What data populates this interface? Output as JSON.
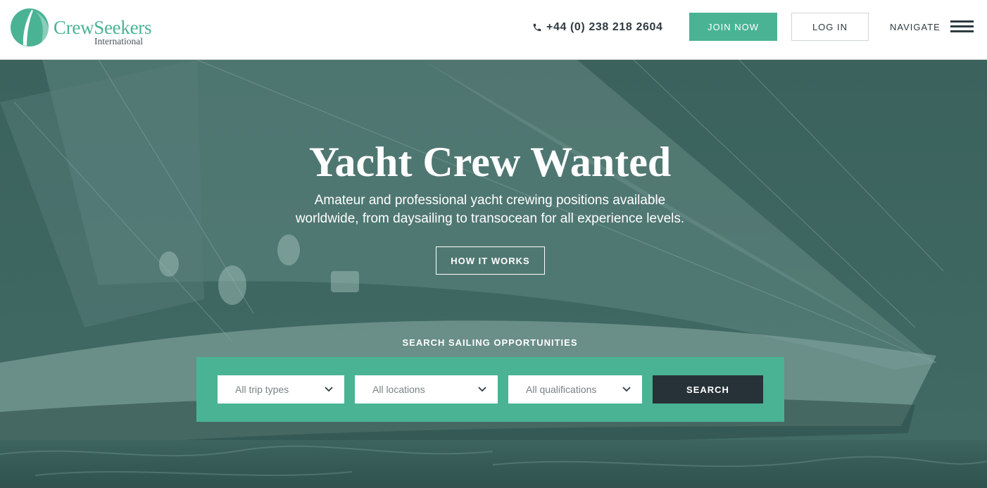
{
  "brand": {
    "name": "CrewSeekers",
    "subtitle": "International",
    "color": "#4ab393"
  },
  "header": {
    "phone": "+44 (0) 238 218 2604",
    "join_label": "JOIN NOW",
    "login_label": "LOG IN",
    "navigate_label": "NAVIGATE"
  },
  "hero": {
    "title": "Yacht Crew Wanted",
    "subtitle_line1": "Amateur and professional yacht crewing positions available",
    "subtitle_line2": "worldwide, from daysailing to transocean for all experience levels.",
    "how_label": "HOW IT WORKS"
  },
  "search": {
    "heading": "SEARCH SAILING OPPORTUNITIES",
    "trip_types": "All trip types",
    "locations": "All locations",
    "qualifications": "All qualifications",
    "button_label": "SEARCH"
  },
  "colors": {
    "accent": "#4ab393",
    "dark": "#263238",
    "hero_overlay": "#3f6762"
  },
  "icons": {
    "phone": "phone-icon",
    "menu": "hamburger-icon",
    "dropdown": "chevron-down-icon"
  }
}
